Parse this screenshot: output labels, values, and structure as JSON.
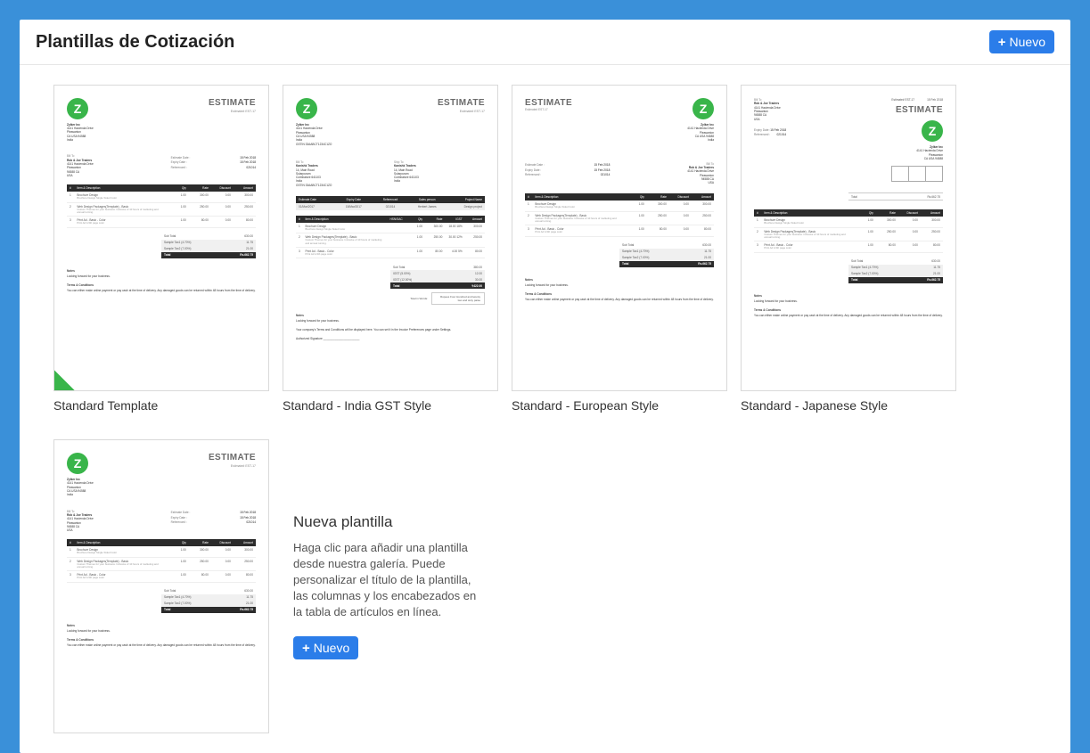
{
  "header": {
    "title": "Plantillas de Cotización",
    "new_button": "Nuevo"
  },
  "templates": [
    {
      "id": "standard",
      "name": "Standard Template",
      "default": true
    },
    {
      "id": "gst",
      "name": "Standard - India GST Style",
      "default": false
    },
    {
      "id": "euro",
      "name": "Standard - European Style",
      "default": false
    },
    {
      "id": "japan",
      "name": "Standard - Japanese Style",
      "default": false
    },
    {
      "id": "standard2",
      "name": "",
      "default": false
    }
  ],
  "new_tile": {
    "title": "Nueva plantilla",
    "text": "Haga clic para añadir una plantilla desde nuestra galería. Puede personalizar el título de la plantilla, las columnas y los encabezados en la tabla de artículos en línea.",
    "button": "Nuevo"
  },
  "sample": {
    "doc_title": "ESTIMATE",
    "doc_no": "Estimate# EST-17",
    "date_label": "15 Feb 2018",
    "company": {
      "name": "Zylker Inc",
      "addr1": "4141 Hacienda Drive",
      "addr2": "Pleasanton",
      "addr3": "CA USA 94588",
      "addr4": "India"
    },
    "billto_label": "Bill To",
    "billto": {
      "name": "Rob & Joe Traders",
      "addr1": "4141 Hacienda Drive",
      "addr2": "Pleasanton",
      "addr3": "94588 CA",
      "addr4": "USA"
    },
    "info": [
      {
        "k": "Estimate Date :",
        "v": "15 Feb 2018"
      },
      {
        "k": "Expiry Date :",
        "v": "15 Feb 2018"
      },
      {
        "k": "Reference# :",
        "v": "021014"
      }
    ],
    "cols": [
      "Item & Description",
      "Qty",
      "Rate",
      "Discount",
      "Amount"
    ],
    "rows": [
      {
        "n": "1",
        "name": "Brochure Design",
        "desc": "Brochure Design Single Sided Color",
        "qty": "1.00",
        "rate": "300.00",
        "disc": "0.00",
        "amt": "300.00"
      },
      {
        "n": "2",
        "name": "Web Design Packages(Template) - Basic",
        "desc": "Custom Themes for your business. Inclusive of 10 hours of marketing and annual turning.",
        "qty": "1.00",
        "rate": "250.00",
        "disc": "0.00",
        "amt": "250.00"
      },
      {
        "n": "3",
        "name": "Print Ad - Basic - Color",
        "desc": "Print Ad 1/4th page color",
        "qty": "1.00",
        "rate": "80.00",
        "disc": "0.00",
        "amt": "80.00"
      }
    ],
    "totals": [
      {
        "k": "Sub Total",
        "v": "630.00",
        "shade": false
      },
      {
        "k": "Sample Tax1 (4.70%)",
        "v": "11.75",
        "shade": true
      },
      {
        "k": "Sample Tax2 (7.00%)",
        "v": "21.00",
        "shade": true
      }
    ],
    "grand": {
      "k": "Total",
      "v": "Rs.662.75"
    },
    "notes_label": "Notes",
    "notes_text": "Looking forward for your business.",
    "terms_label": "Terms & Conditions",
    "terms_text": "You can either make online payment or pay cash at the time of delivery. Any damaged goods can be returned within 48 hours from the time of delivery."
  },
  "gst_extra": {
    "shipto_label": "Ship To",
    "shipto": {
      "name": "Kanishk Traders",
      "addr1": "14, Main Road",
      "addr2": "Solarpuram",
      "addr3": "Coimbatore 641103",
      "addr4": "India",
      "gstin": "GSTIN 33AABCT1234C1ZO"
    },
    "company_gstin": "GSTIN 33AABCT1234C1ZO",
    "bar_labels": [
      "Estimate Date",
      "Expiry Date",
      "Reference#",
      "Sales person",
      "Project Name"
    ],
    "bar_vals": [
      "01/Mar/2017",
      "15/Mar/2017",
      "021014",
      "Herbert James",
      "Design project"
    ],
    "cols": [
      "Item & Description",
      "HSN/SAC",
      "Qty",
      "Rate",
      "IGST",
      "Amount"
    ],
    "totals": [
      {
        "k": "Sub Total",
        "v": "380.00"
      },
      {
        "k": "IGST (5.00%)",
        "v": "12.00"
      },
      {
        "k": "IGST (12.00%)",
        "v": "30.00"
      }
    ],
    "grand": {
      "k": "Total",
      "v": "₹422.00"
    },
    "words_label": "Total in Words:",
    "words": "Rupees Four Hundred and twenty two and sixty paise",
    "terms_text": "Your company's Terms and Conditions will be displayed here. You can set it in the Invoice Preferences page under Settings.",
    "sig_label": "Authorized Signature _______________________"
  }
}
